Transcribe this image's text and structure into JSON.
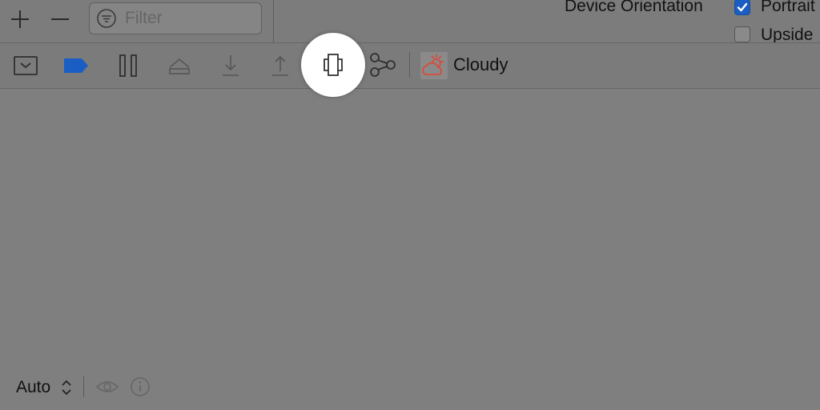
{
  "top": {
    "filter_placeholder": "Filter",
    "device_orientation_label": "Device Orientation",
    "portrait_label": "Portrait",
    "portrait_checked": true,
    "upside_label": "Upside",
    "upside_checked": false
  },
  "toolbar": {
    "scene_name": "Cloudy",
    "highlighted_tool": "component-view-icon"
  },
  "bottom": {
    "zoom_label": "Auto"
  },
  "colors": {
    "background": "#7f7f7f",
    "accent_blue": "#1a5ec3",
    "scene_icon_red": "#d74c3a",
    "highlight": "#ffffff"
  }
}
